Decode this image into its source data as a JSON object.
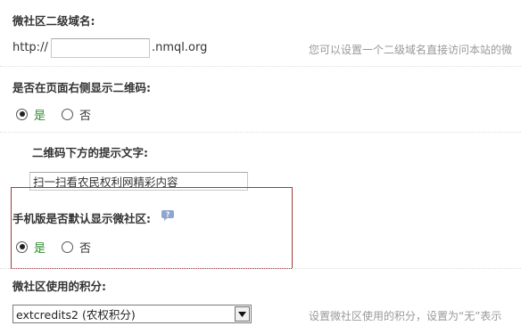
{
  "domain_field": {
    "label": "微社区二级域名:",
    "prefix": "http://",
    "value": "",
    "suffix": ".nmql.org",
    "hint": "您可以设置一个二级域名直接访问本站的微"
  },
  "qrcode_display": {
    "label": "是否在页面右侧显示二维码:",
    "options": [
      "是",
      "否"
    ],
    "selected": "是"
  },
  "qrcode_text": {
    "label": "二维码下方的提示文字:",
    "value": "扫一扫看农民权利网精彩内容"
  },
  "mobile_default": {
    "label": "手机版是否默认显示微社区:",
    "help_icon": "question-bubble-icon",
    "options": [
      "是",
      "否"
    ],
    "selected": "是",
    "highlight_color": "#a33a3a"
  },
  "credits": {
    "label": "微社区使用的积分:",
    "selected_option": "extcredits2 (农权积分)",
    "hint": "设置微社区使用的积分，设置为“无”表示"
  },
  "colors": {
    "yes_label": "#2e8b2e",
    "hint_text": "#999999",
    "highlight_border": "#a33a3a"
  }
}
